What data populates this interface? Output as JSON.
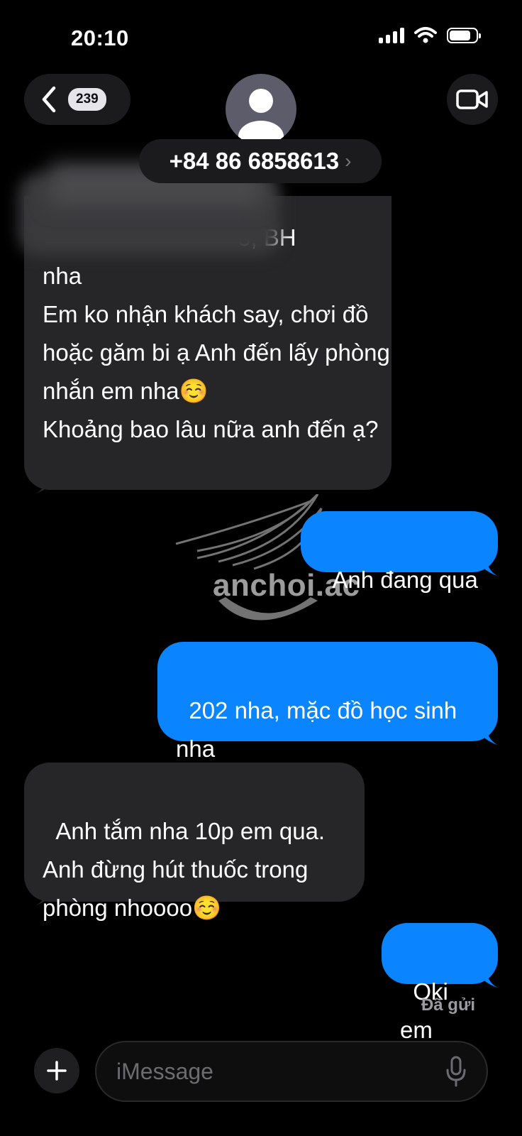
{
  "status_bar": {
    "time": "20:10"
  },
  "header": {
    "badge_count": "239",
    "contact_name": "+84 86 6858613",
    "contact_chevron": "›"
  },
  "messages": [
    {
      "direction": "incoming",
      "partial_text": "(\n                              o, BH\nnha\nEm ko nhận khách say, chơi đồ hoặc găm bi ạ Anh đến lấy phòng nhắn em nha☺️\nKhoảng bao lâu nữa anh đến ạ?"
    },
    {
      "direction": "outgoing",
      "text": "Anh đang qua"
    },
    {
      "direction": "outgoing",
      "text": "202 nha, mặc đồ học sinh nha"
    },
    {
      "direction": "incoming",
      "text": "Anh tắm nha 10p em qua.\nAnh đừng hút thuốc trong phòng nhoooo☺️"
    },
    {
      "direction": "outgoing",
      "text": "Oki em"
    }
  ],
  "delivery_status": "Đã gửi",
  "watermark": "anchoi.ac",
  "composer": {
    "placeholder": "iMessage"
  },
  "colors": {
    "outgoing_bubble": "#0a84ff",
    "incoming_bubble": "#262628",
    "background": "#000000"
  },
  "icons": [
    "back-chevron-icon",
    "person-avatar-icon",
    "video-camera-icon",
    "plus-icon",
    "microphone-icon",
    "wifi-icon",
    "signal-icon",
    "battery-icon"
  ]
}
